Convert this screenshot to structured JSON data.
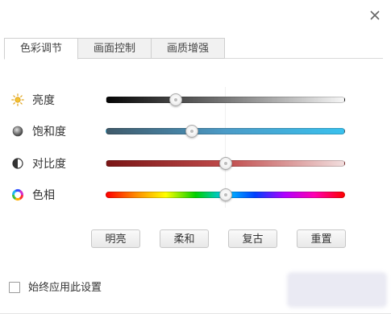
{
  "tabs": [
    {
      "label": "色彩调节",
      "active": true
    },
    {
      "label": "画面控制",
      "active": false
    },
    {
      "label": "画质增强",
      "active": false
    }
  ],
  "sliders": [
    {
      "label": "亮度",
      "icon": "sun-icon",
      "value": 0.29
    },
    {
      "label": "饱和度",
      "icon": "saturation-icon",
      "value": 0.36
    },
    {
      "label": "对比度",
      "icon": "contrast-icon",
      "value": 0.5
    },
    {
      "label": "色相",
      "icon": "hue-wheel-icon",
      "value": 0.5
    }
  ],
  "presets": [
    "明亮",
    "柔和",
    "复古",
    "重置"
  ],
  "apply_always": {
    "label": "始终应用此设置",
    "checked": false
  },
  "colors": {
    "brightness_track": [
      "#050505",
      "#777777",
      "#f6f6f6"
    ],
    "saturation_track": [
      "#3f5a6a",
      "#4b9bc7",
      "#39c1ee"
    ],
    "contrast_track": [
      "#7a1515",
      "#c04a4a",
      "#f2dede"
    ],
    "hue_track": [
      "#ff0000",
      "#ff8c00",
      "#ffff00",
      "#00d000",
      "#00c8ff",
      "#0040ff",
      "#b000ff",
      "#ff00b0",
      "#ff0000"
    ]
  }
}
